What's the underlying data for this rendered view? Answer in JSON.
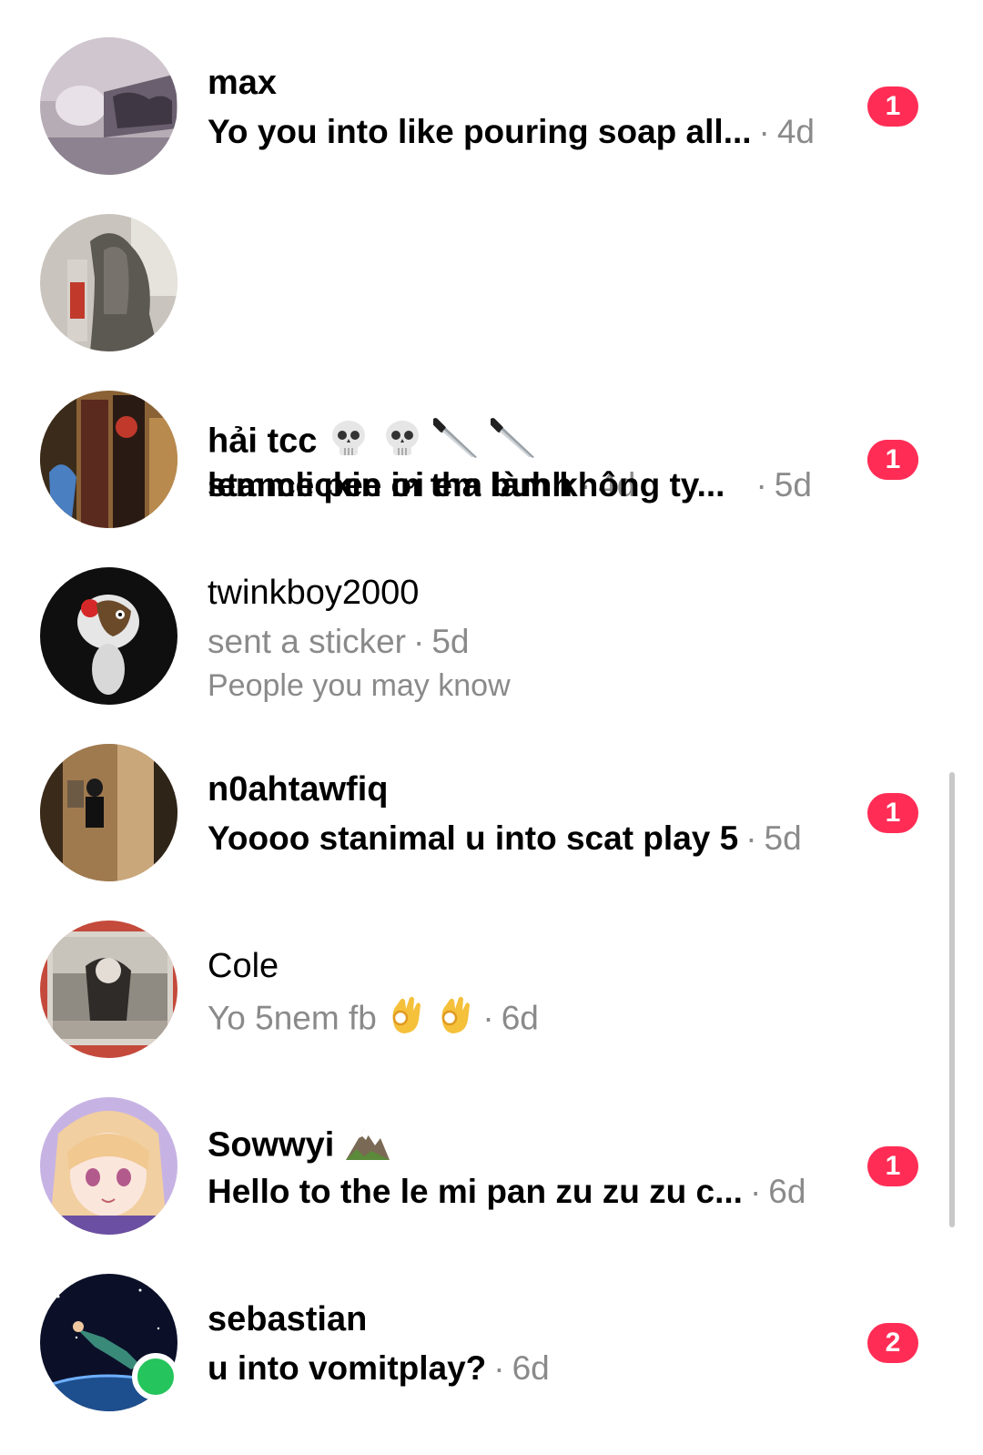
{
  "conversations": [
    {
      "name": "max",
      "name_bold": true,
      "preview": "Yo you into like pouring soap all...",
      "preview_bold": true,
      "separator": "·",
      "time": "4d",
      "unread": "1",
      "avatar_color": "#a89aa6"
    },
    {
      "name": "",
      "name_bold": true,
      "preview": "lemme pee in tha buhh",
      "preview_bold": true,
      "separator": "·",
      "time": "4d",
      "unread": "1",
      "avatar_color": "#8f8a84"
    },
    {
      "name": "hải tcc",
      "name_bold": true,
      "name_emojis": [
        "skull-emoji",
        "skull-emoji",
        "knife-emoji",
        "knife-emoji"
      ],
      "preview": "stanclickin ơi em làm không ty...",
      "preview_bold": true,
      "separator": "·",
      "time": "5d",
      "unread": "1",
      "avatar_color": "#6b4a2a"
    },
    {
      "name": "twinkboy2000",
      "name_bold": false,
      "preview": "sent a sticker",
      "preview_bold": false,
      "separator": "·",
      "time": "5d",
      "subtitle": "People you may know",
      "avatar_color": "#111111"
    },
    {
      "name": "n0ahtawfiq",
      "name_bold": true,
      "preview": "Yoooo stanimal u into scat play 5",
      "preview_bold": true,
      "separator": "·",
      "time": "5d",
      "unread": "1",
      "avatar_color": "#7a5230"
    },
    {
      "name": "Cole",
      "name_bold": false,
      "preview": "Yo 5nem fb",
      "preview_emojis": [
        "ok-hand-emoji",
        "ok-hand-emoji"
      ],
      "preview_bold": false,
      "separator": "·",
      "time": "6d",
      "avatar_color": "#9c958c"
    },
    {
      "name": "Sowwyi",
      "name_bold": true,
      "name_emojis": [
        "mountain-emoji"
      ],
      "preview": "Hello to the le mi pan zu zu zu c...",
      "preview_bold": true,
      "separator": "·",
      "time": "6d",
      "unread": "1",
      "avatar_color": "#e9c9d8"
    },
    {
      "name": "sebastian",
      "name_bold": true,
      "preview": "u into vomitplay?",
      "preview_bold": true,
      "separator": "·",
      "time": "6d",
      "unread": "2",
      "online": true,
      "avatar_color": "#0d1530"
    }
  ],
  "colors": {
    "badge": "#ff2d55",
    "online": "#25c45c",
    "secondary_text": "#8a8a8a"
  }
}
